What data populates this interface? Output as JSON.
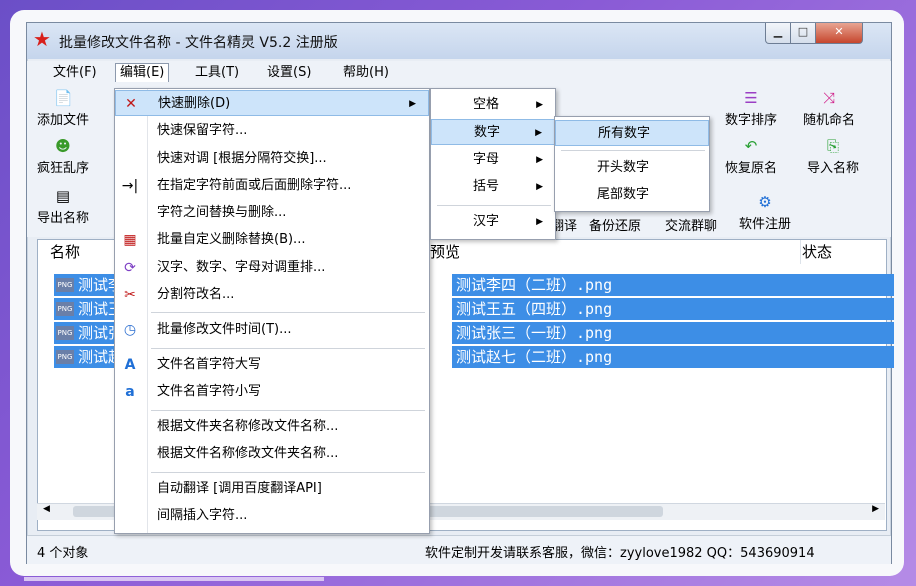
{
  "window": {
    "title": "批量修改文件名称 - 文件名精灵 V5.2 注册版"
  },
  "menubar": [
    "文件(F)",
    "编辑(E)",
    "工具(T)",
    "设置(S)",
    "帮助(H)"
  ],
  "toolbar": {
    "add_file": "添加文件",
    "crazy_shuffle": "疯狂乱序",
    "export_name": "导出名称",
    "number_sort": "数字排序",
    "random_name": "随机命名",
    "restore_name": "恢复原名",
    "import_name": "导入名称",
    "translate_partial": "翻译",
    "backup_restore": "备份还原",
    "chat_group": "交流群聊",
    "register": "软件注册"
  },
  "columns": {
    "name": "名称",
    "preview": "预览",
    "status": "状态"
  },
  "files": [
    {
      "name": "测试李",
      "preview": "测试李四（二班）.png"
    },
    {
      "name": "测试王",
      "preview": "测试王五（四班）.png"
    },
    {
      "name": "测试张",
      "preview": "测试张三（一班）.png"
    },
    {
      "name": "测试赵",
      "preview": "测试赵七（二班）.png"
    }
  ],
  "status": {
    "count": "4 个对象",
    "contact": "软件定制开发请联系客服，微信：zyylove1982  QQ：543690914"
  },
  "edit_menu": [
    "快速删除(D)",
    "快速保留字符...",
    "快速对调 [根据分隔符交换]...",
    "在指定字符前面或后面删除字符...",
    "字符之间替换与删除...",
    "批量自定义删除替换(B)...",
    "汉字、数字、字母对调重排...",
    "分割符改名...",
    "批量修改文件时间(T)...",
    "文件名首字符大写",
    "文件名首字符小写",
    "根据文件夹名称修改文件名称...",
    "根据文件名称修改文件夹名称...",
    "自动翻译 [调用百度翻译API]",
    "间隔插入字符..."
  ],
  "delete_submenu": [
    "空格",
    "数字",
    "字母",
    "括号",
    "汉字"
  ],
  "number_submenu": [
    "所有数字",
    "开头数字",
    "尾部数字"
  ],
  "png_label": "PNG"
}
